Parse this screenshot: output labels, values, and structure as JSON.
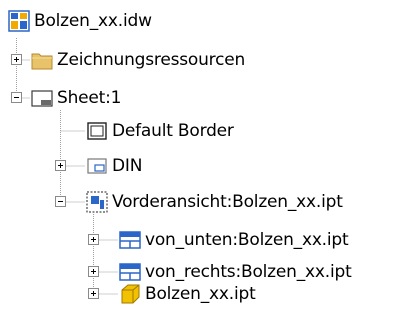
{
  "tree": {
    "root": {
      "label": "Bolzen_xx.idw",
      "icon": "drawing-document-icon"
    },
    "items": [
      {
        "label": "Zeichnungsressourcen",
        "icon": "folder-icon",
        "state": "collapsed"
      },
      {
        "label": "Sheet:1",
        "icon": "sheet-icon",
        "state": "expanded"
      },
      {
        "label": "Default Border",
        "icon": "border-icon",
        "state": "leaf"
      },
      {
        "label": "DIN",
        "icon": "title-block-icon",
        "state": "collapsed"
      },
      {
        "label": "Vorderansicht:Bolzen_xx.ipt",
        "icon": "base-view-icon",
        "state": "expanded"
      },
      {
        "label": "von_unten:Bolzen_xx.ipt",
        "icon": "projected-view-icon",
        "state": "collapsed"
      },
      {
        "label": "von_rechts:Bolzen_xx.ipt",
        "icon": "projected-view-icon",
        "state": "collapsed"
      },
      {
        "label": "Bolzen_xx.ipt",
        "icon": "part-icon",
        "state": "collapsed"
      }
    ]
  },
  "colors": {
    "tree_lines": "#a0a0a0",
    "folder": "#e8c36a",
    "part": "#f2c200",
    "view_blue": "#2b66c9"
  }
}
